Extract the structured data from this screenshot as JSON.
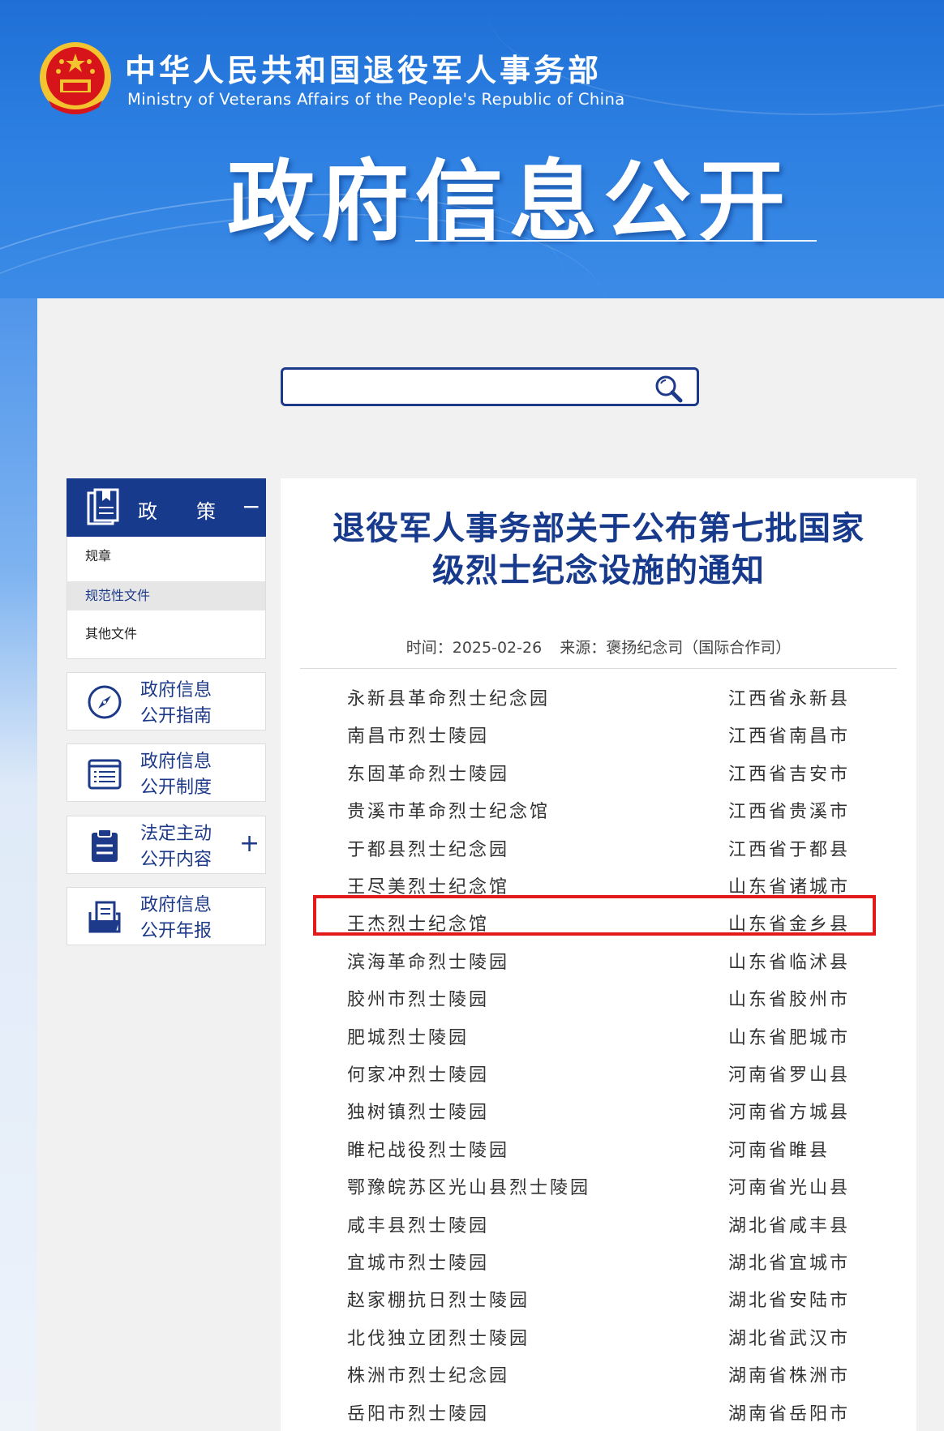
{
  "header": {
    "ministry_cn": "中华人民共和国退役军人事务部",
    "ministry_en": "Ministry of Veterans Affairs of the People's Republic of China",
    "banner_title": "政府信息公开"
  },
  "search": {
    "value": "",
    "placeholder": ""
  },
  "sidebar": {
    "section_title_a": "政",
    "section_title_b": "策",
    "collapse_symbol": "−",
    "items": [
      {
        "label": "规章"
      },
      {
        "label": "规范性文件"
      },
      {
        "label": "其他文件"
      }
    ],
    "cards": [
      {
        "line1": "政府信息",
        "line2": "公开指南",
        "icon": "compass-icon"
      },
      {
        "line1": "政府信息",
        "line2": "公开制度",
        "icon": "list-document-icon"
      },
      {
        "line1": "法定主动",
        "line2": "公开内容",
        "icon": "clipboard-icon",
        "expand": "+"
      },
      {
        "line1": "政府信息",
        "line2": "公开年报",
        "icon": "folder-report-icon"
      }
    ]
  },
  "article": {
    "title_line1": "退役军人事务部关于公布第七批国家",
    "title_line2": "级烈士纪念设施的通知",
    "time_label": "时间：2025-02-26",
    "source_label": "来源：褒扬纪念司（国际合作司）",
    "rows": [
      {
        "name": "永新县革命烈士纪念园",
        "place": "江西省永新县"
      },
      {
        "name": "南昌市烈士陵园",
        "place": "江西省南昌市"
      },
      {
        "name": "东固革命烈士陵园",
        "place": "江西省吉安市"
      },
      {
        "name": "贵溪市革命烈士纪念馆",
        "place": "江西省贵溪市"
      },
      {
        "name": "于都县烈士纪念园",
        "place": "江西省于都县"
      },
      {
        "name": "王尽美烈士纪念馆",
        "place": "山东省诸城市"
      },
      {
        "name": "王杰烈士纪念馆",
        "place": "山东省金乡县"
      },
      {
        "name": "滨海革命烈士陵园",
        "place": "山东省临沭县"
      },
      {
        "name": "胶州市烈士陵园",
        "place": "山东省胶州市"
      },
      {
        "name": "肥城烈士陵园",
        "place": "山东省肥城市"
      },
      {
        "name": "何家冲烈士陵园",
        "place": "河南省罗山县"
      },
      {
        "name": "独树镇烈士陵园",
        "place": "河南省方城县"
      },
      {
        "name": "睢杞战役烈士陵园",
        "place": "河南省睢县"
      },
      {
        "name": "鄂豫皖苏区光山县烈士陵园",
        "place": "河南省光山县"
      },
      {
        "name": "咸丰县烈士陵园",
        "place": "湖北省咸丰县"
      },
      {
        "name": "宜城市烈士陵园",
        "place": "湖北省宜城市"
      },
      {
        "name": "赵家棚抗日烈士陵园",
        "place": "湖北省安陆市"
      },
      {
        "name": "北伐独立团烈士陵园",
        "place": "湖北省武汉市"
      },
      {
        "name": "株洲市烈士纪念园",
        "place": "湖南省株洲市"
      },
      {
        "name": "岳阳市烈士陵园",
        "place": "湖南省岳阳市"
      }
    ]
  },
  "colors": {
    "brand_blue": "#173a8c",
    "highlight_red": "#e21a1a",
    "header_blue": "#2c7fe1"
  }
}
